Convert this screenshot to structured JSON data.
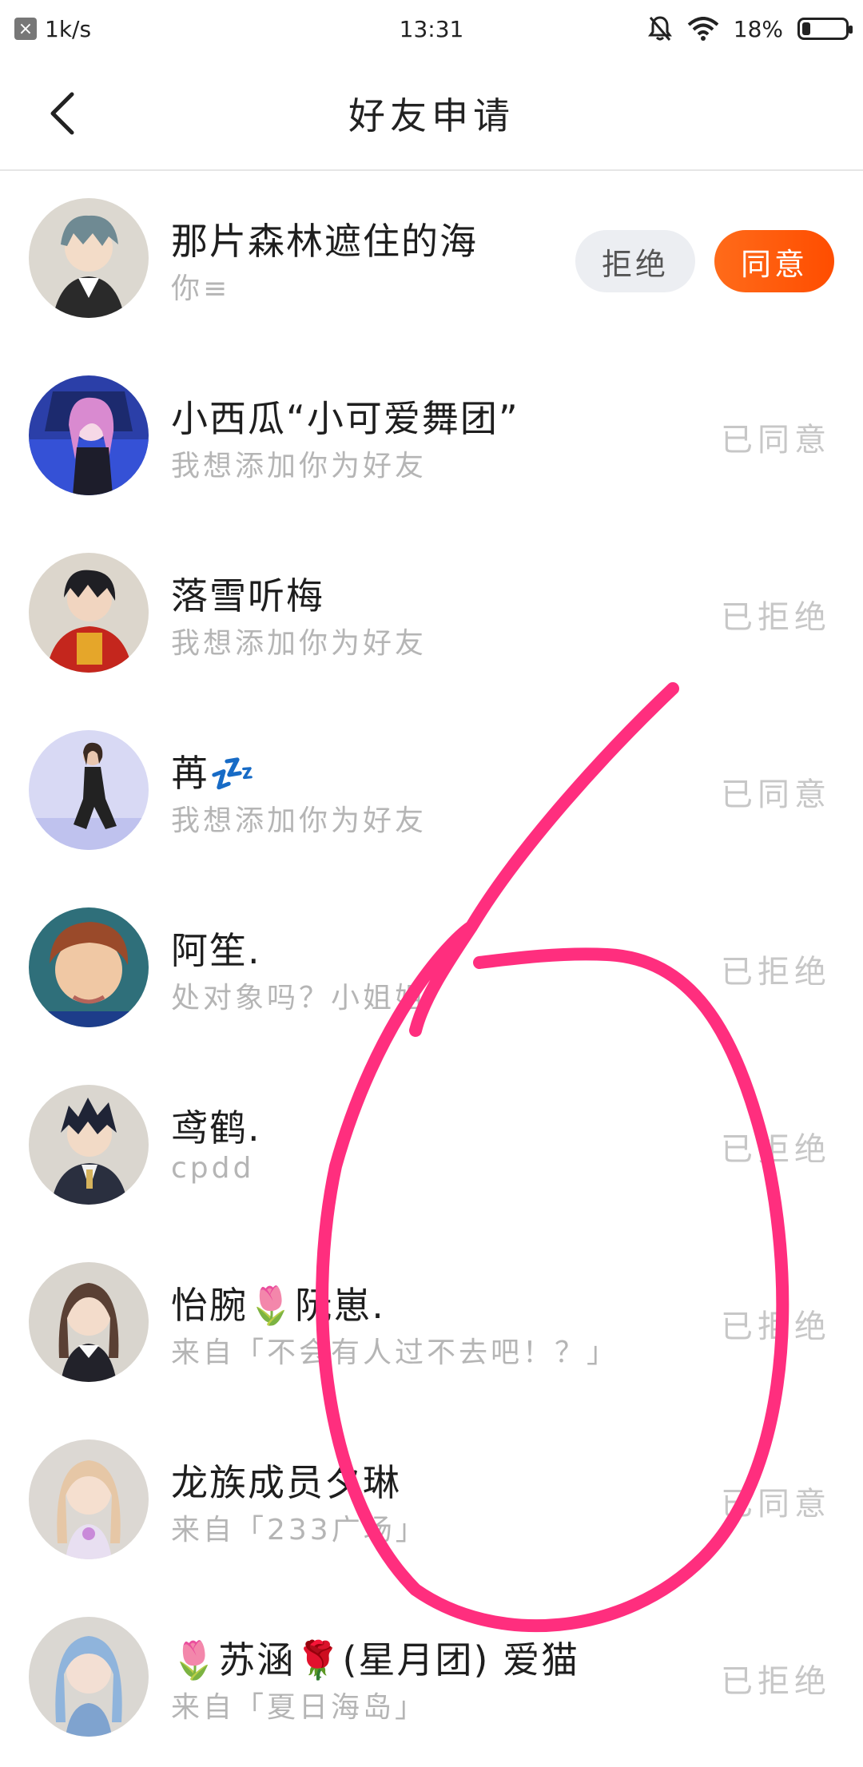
{
  "status_bar": {
    "speed": "1k/s",
    "time": "13:31",
    "battery": "18%",
    "icons": [
      "notification-close-icon",
      "mute-bell-icon",
      "wifi-icon",
      "battery-icon"
    ]
  },
  "header": {
    "title": "好友申请",
    "back_icon": "chevron-left-icon"
  },
  "requests": [
    {
      "name": "那片森林遮住的海",
      "message": "你≡",
      "status": "",
      "actions": {
        "reject": "拒绝",
        "accept": "同意"
      }
    },
    {
      "name": "小西瓜“小可爱舞团”",
      "message": "我想添加你为好友",
      "status": "已同意"
    },
    {
      "name": "落雪听梅",
      "message": "我想添加你为好友",
      "status": "已拒绝"
    },
    {
      "name": "苒💤",
      "message": "我想添加你为好友",
      "status": "已同意"
    },
    {
      "name": "阿笙.",
      "message": "处对象吗？小姐姐",
      "status": "已拒绝"
    },
    {
      "name": "鸢鹤.",
      "message": "cpdd",
      "status": "已拒绝"
    },
    {
      "name": "怡腕🌷阮崽.",
      "message": "来自「不会有人过不去吧！？」",
      "status": "已拒绝"
    },
    {
      "name": "龙族成员夕琳",
      "message": "来自「233广场」",
      "status": "已同意"
    },
    {
      "name": "🌷苏涵🌹(星月团) 爱猫",
      "message": "来自「夏日海岛」",
      "status": "已拒绝"
    }
  ],
  "colors": {
    "accent": "#ff5a0a",
    "annotation": "#ff2e7e",
    "status_text": "#c7c7c7"
  }
}
